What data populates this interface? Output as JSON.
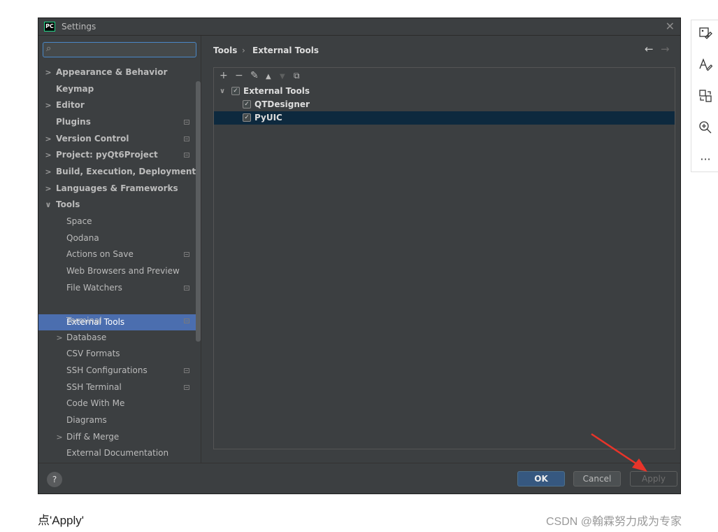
{
  "dialog": {
    "title": "Settings",
    "app_icon_label": "PC",
    "close_glyph": "✕"
  },
  "search": {
    "placeholder": "",
    "value": ""
  },
  "sidebar": {
    "items": [
      {
        "label": "Appearance & Behavior",
        "arrow": ">"
      },
      {
        "label": "Keymap",
        "arrow": ""
      },
      {
        "label": "Editor",
        "arrow": ">"
      },
      {
        "label": "Plugins",
        "arrow": ""
      },
      {
        "label": "Version Control",
        "arrow": ">"
      },
      {
        "label": "Project: pyQt6Project",
        "arrow": ">"
      },
      {
        "label": "Build, Execution, Deployment",
        "arrow": ">"
      },
      {
        "label": "Languages & Frameworks",
        "arrow": ">"
      },
      {
        "label": "Tools",
        "arrow": "∨"
      },
      {
        "label": "Space",
        "arrow": ""
      },
      {
        "label": "Qodana",
        "arrow": ""
      },
      {
        "label": "Actions on Save",
        "arrow": ""
      },
      {
        "label": "Web Browsers and Preview",
        "arrow": ""
      },
      {
        "label": "File Watchers",
        "arrow": ""
      },
      {
        "label": "External Tools",
        "arrow": ""
      },
      {
        "label": "Terminal",
        "arrow": ""
      },
      {
        "label": "Database",
        "arrow": ">"
      },
      {
        "label": "CSV Formats",
        "arrow": ""
      },
      {
        "label": "SSH Configurations",
        "arrow": ""
      },
      {
        "label": "SSH Terminal",
        "arrow": ""
      },
      {
        "label": "Code With Me",
        "arrow": ""
      },
      {
        "label": "Diagrams",
        "arrow": ""
      },
      {
        "label": "Diff & Merge",
        "arrow": ">"
      },
      {
        "label": "External Documentation",
        "arrow": ""
      }
    ],
    "selected": "External Tools"
  },
  "breadcrumb": {
    "parent": "Tools",
    "separator": "›",
    "current": "External Tools",
    "back_glyph": "←",
    "forward_glyph": "→"
  },
  "toolbar": {
    "add": "+",
    "remove": "−",
    "edit": "✎",
    "move_up": "▲",
    "move_down": "▼",
    "copy": "⧉"
  },
  "tools_tree": {
    "group": {
      "label": "External Tools",
      "checked": true,
      "expanded": true
    },
    "items": [
      {
        "label": "QTDesigner",
        "checked": true
      },
      {
        "label": "PyUIC",
        "checked": true,
        "selected": true
      }
    ]
  },
  "buttons": {
    "help": "?",
    "ok": "OK",
    "cancel": "Cancel",
    "apply": "Apply"
  },
  "right_toolbar": {
    "icons": [
      "image-edit-icon",
      "text-style-icon",
      "translate-icon",
      "zoom-in-icon",
      "more-icon"
    ],
    "more_glyph": "···"
  },
  "caption": "点'Apply'",
  "watermark": "CSDN @翰霖努力成为专家",
  "colors": {
    "dialog_bg": "#3c3f41",
    "selection": "#4b6eaf",
    "row_selection": "#0d293e",
    "ok_button": "#365880",
    "annotation_arrow": "#e8342a"
  }
}
